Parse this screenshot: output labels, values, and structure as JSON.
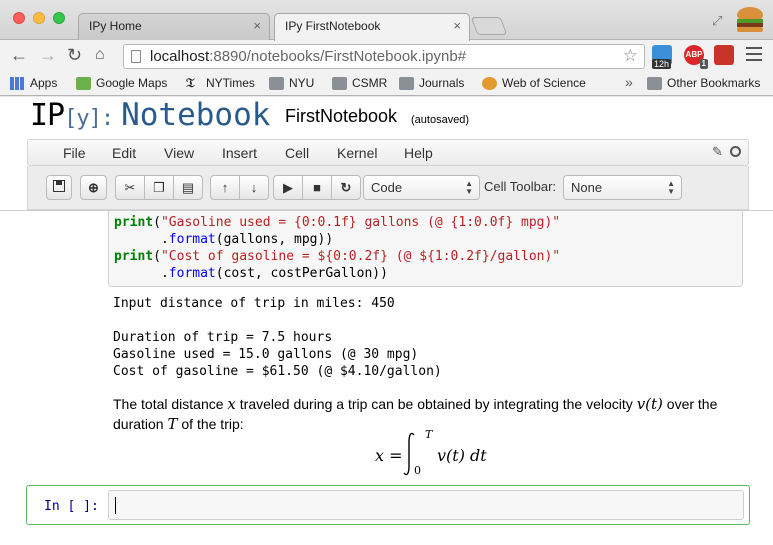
{
  "browser": {
    "tabs": [
      {
        "label": "IPy Home",
        "close": "×"
      },
      {
        "label": "IPy FirstNotebook",
        "close": "×"
      }
    ],
    "url_host": "localhost",
    "url_path": ":8890/notebooks/FirstNotebook.ipynb#",
    "extension_badges": {
      "calendar": "12h",
      "adblock": "ABP",
      "adblock_count": "1"
    },
    "bookmarks": [
      "Apps",
      "Google Maps",
      "NYTimes",
      "NYU",
      "CSMR",
      "Journals",
      "Web of Science"
    ],
    "bookmarks_overflow": "»",
    "other_bookmarks": "Other Bookmarks"
  },
  "ipython": {
    "logo_ip": "IP",
    "logo_y": "[y]:",
    "logo_notebook": "Notebook",
    "notebook_name": "FirstNotebook",
    "autosave_status": "(autosaved)",
    "menus": [
      "File",
      "Edit",
      "View",
      "Insert",
      "Cell",
      "Kernel",
      "Help"
    ],
    "cell_type_select": "Code",
    "cell_toolbar_label": "Cell Toolbar:",
    "cell_toolbar_select": "None"
  },
  "cells": {
    "code_lines": [
      {
        "kw": "print",
        "p1": "(",
        "str": "\"Gasoline used = {0:0.1f} gallons (@ {1:0.0f} mpg)\"",
        "rest": ""
      },
      {
        "kw": "",
        "p1": "      .",
        "str": "",
        "fn": "format",
        "rest": "(gallons, mpg))"
      },
      {
        "kw": "print",
        "p1": "(",
        "str": "\"Cost of gasoline = ${0:0.2f} (@ ${1:0.2f}/gallon)\"",
        "rest": ""
      },
      {
        "kw": "",
        "p1": "      .",
        "str": "",
        "fn": "format",
        "rest": "(cost, costPerGallon))"
      }
    ],
    "output_lines": [
      "Input distance of trip in miles: 450",
      "",
      "Duration of trip = 7.5 hours",
      "Gasoline used = 15.0 gallons (@ 30 mpg)",
      "Cost of gasoline = $61.50 (@ $4.10/gallon)"
    ],
    "markdown": {
      "before_x": "The total distance ",
      "x": "x",
      "mid": " traveled during a trip can be obtained by integrating the velocity ",
      "vt": "v(t)",
      "after_vt": " over the duration ",
      "T": "T",
      "end": " of the trip:"
    },
    "equation": {
      "lhs": "x =",
      "upper": "T",
      "lower": "0",
      "integrand": "v(t) dt"
    },
    "input_prompt": "In [ ]:"
  }
}
